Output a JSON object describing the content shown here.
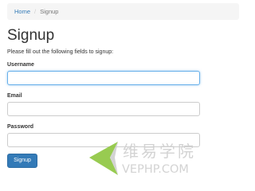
{
  "breadcrumb": {
    "home_label": "Home",
    "separator": "/",
    "current_label": "Signup"
  },
  "page": {
    "title": "Signup",
    "intro": "Please fill out the following fields to signup:"
  },
  "form": {
    "username": {
      "label": "Username",
      "value": "",
      "focused": true
    },
    "email": {
      "label": "Email",
      "value": ""
    },
    "password": {
      "label": "Password",
      "value": ""
    },
    "submit_label": "Signup"
  },
  "watermark": {
    "cn_text": "维易学院",
    "en_text": "VEPHP.COM",
    "colors": {
      "green": "#8dc63f",
      "gray": "#cfcfcf"
    }
  },
  "colors": {
    "link": "#337ab7",
    "primary_button": "#337ab7",
    "focus_border": "#66afe9",
    "breadcrumb_bg": "#f5f5f5"
  }
}
